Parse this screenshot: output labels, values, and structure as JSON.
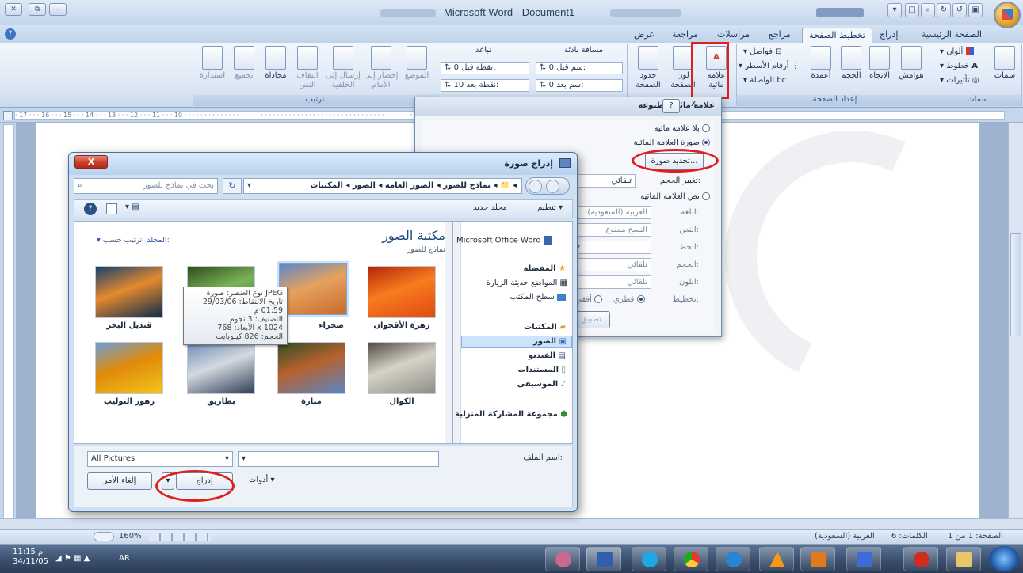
{
  "window": {
    "title": "Microsoft Word - Document1"
  },
  "ribbon": {
    "tabs": [
      "الصفحة الرئيسية",
      "إدراج",
      "تخطيط الصفحة",
      "مراجع",
      "مراسلات",
      "مراجعة",
      "عرض"
    ],
    "active_tab": "تخطيط الصفحة",
    "groups": {
      "themes": {
        "label": "سمات",
        "themes_btn": "سمات",
        "colors": "ألوان",
        "fonts": "خطوط",
        "effects": "تأثيرات"
      },
      "page_setup": {
        "label": "إعداد الصفحة",
        "margins": "هوامش",
        "orientation": "الاتجاه",
        "size": "الحجم",
        "columns": "أعمدة",
        "breaks": "فواصل",
        "line_numbers": "أرقام الأسطر",
        "hyphenation": "الواصلة"
      },
      "page_background": {
        "watermark_1": "علامة",
        "watermark_2": "مائية",
        "page_color_1": "لون",
        "page_color_2": "الصفحة",
        "borders_1": "حدود",
        "borders_2": "الصفحة"
      },
      "paragraph": {
        "indent": "مسافة بادئة",
        "spacing": "تباعد",
        "before": "قبل:",
        "after": "بعد:",
        "indent_before_value": "0 سم",
        "indent_after_value": "0 سم",
        "spacing_before_value": "0 نقطة",
        "spacing_after_value": "10 نقطة"
      },
      "arrange": {
        "label": "ترتيب",
        "position": "الموضع",
        "bring_front": "إحضار إلى",
        "bring_front_2": "الأمام",
        "send_back": "إرسال إلى",
        "send_back_2": "الخلفية",
        "wrap": "التفاف",
        "wrap_2": "النص",
        "align": "محاذاة",
        "group": "تجميع",
        "rotate": "استدارة"
      }
    }
  },
  "ruler_marks": "· 17 · · · 16 · · · 15 · · · 14 · · · 13 · · · 12 · · · 11 · · · 10 · · · · · · · · · · · · · · · · · · · · · · · · · · · · · · · · · · · · · · · · · · · · · · · · · · · · · · · · · · 2 · · · 1 · · · · · · · 1 · · · 2 · · · 3",
  "watermark_dialog": {
    "title": "علامة مائية مطبوعة",
    "help": "?",
    "close": "X",
    "no_watermark": "بلا علامة مائية",
    "picture_watermark": "صورة العلامة المائية",
    "select_picture": "تحديد صورة...",
    "scale_label": "تغيير الحجم:",
    "scale_value": "تلقائي",
    "text_watermark": "نص العلامة المائية",
    "language_label": "اللغة:",
    "language_value": "العربية (السعودية)",
    "text_label": "النص:",
    "text_value": "النسخ ممنوع",
    "font_label": "الخط:",
    "size_label": "الحجم:",
    "size_value": "تلقائي",
    "color_label": "اللون:",
    "color_value": "تلقائي",
    "layout_label": "تخطيط:",
    "diagonal": "قطري",
    "horizontal": "أفقي",
    "apply": "تطبيق"
  },
  "insert_picture_dialog": {
    "title": "إدراج صورة",
    "close": "X",
    "breadcrumb": [
      "المكتبات",
      "الصور",
      "الصور العامة",
      "نماذج للصور"
    ],
    "search_placeholder": "بحث في نماذج للصور",
    "organize": "تنظيم",
    "new_folder": "مجلد جديد",
    "library_title": "مكتبة الصور",
    "library_subtitle": "نماذج للصور",
    "arrange_by_label": "ترتيب حسب:",
    "arrange_by_value": "المجلد",
    "nav": {
      "word_item": "Microsoft Office Word",
      "favorites": "المفضلة",
      "recent": "المواضع حديثة الزيارة",
      "desktop": "سطح المكتب",
      "libraries": "المكتبات",
      "pictures": "الصور",
      "videos": "الفيديو",
      "documents": "المستندات",
      "music": "الموسيقى",
      "homegroup": "مجموعة المشاركة المنزلية"
    },
    "thumbnails": [
      {
        "label": "زهرة الأقحوان",
        "colors": [
          "#e14a12",
          "#f77c1f",
          "#b42606"
        ]
      },
      {
        "label": "صحراء",
        "colors": [
          "#c96a2d",
          "#e5a15e",
          "#5b87c9"
        ]
      },
      {
        "label": "",
        "colors": [
          "#1f7d3a",
          "#7ab357",
          "#2d4e1c"
        ]
      },
      {
        "label": "قنديل البحر",
        "colors": [
          "#0d2a4d",
          "#e58a2e",
          "#163e6d"
        ]
      },
      {
        "label": "الكوال",
        "colors": [
          "#8b8f87",
          "#d7d2c7",
          "#4e4b44"
        ]
      },
      {
        "label": "منارة",
        "colors": [
          "#5a86c3",
          "#b7612e",
          "#2e4e24"
        ]
      },
      {
        "label": "بطاريق",
        "colors": [
          "#2e3f57",
          "#d4d9e0",
          "#6c8db4"
        ]
      },
      {
        "label": "زهور التوليب",
        "colors": [
          "#f3c41a",
          "#e08a0a",
          "#6aa0d9"
        ]
      }
    ],
    "tooltip": [
      "نوع العنصر: صورة JPEG",
      "تاريخ الالتقاط: 29/03/06 01:59 م",
      "التصنيف: 3 نجوم",
      "الأبعاد: 768 x 1024",
      "الحجم: 826 كيلوبايت"
    ],
    "filename_label": "اسم الملف:",
    "filename_value": "",
    "filetype_value": "All Pictures",
    "tools_label": "أدوات",
    "insert_button": "إدراج",
    "cancel_button": "إلغاء الأمر"
  },
  "status_bar": {
    "page": "الصفحة: 1 من 1",
    "words": "الكلمات: 6",
    "language": "العربية (السعودية)",
    "zoom": "160%"
  },
  "taskbar": {
    "time": "11:15 م",
    "date": "34/11/05",
    "lang": "AR"
  }
}
